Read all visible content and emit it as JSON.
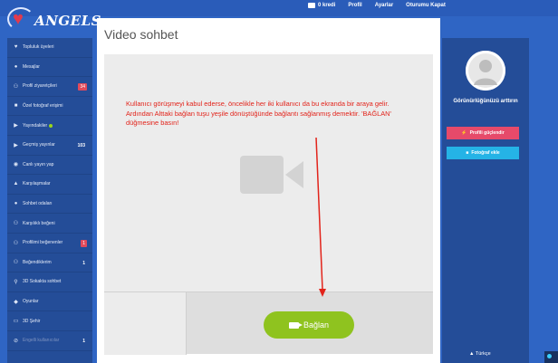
{
  "topnav": {
    "credits": "0 kredi",
    "profile": "Profil",
    "settings": "Ayarlar",
    "logout": "Oturumu Kapat"
  },
  "logo": {
    "text": "ANGELS"
  },
  "sidebar": {
    "items": [
      {
        "label": "Topluluk üyeleri",
        "icon": "heart-icon"
      },
      {
        "label": "Mesajlar",
        "icon": "chat-icon"
      },
      {
        "label": "Profil ziyaretçileri",
        "icon": "users-icon",
        "badge": "34"
      },
      {
        "label": "Özel fotoğraf erişimi",
        "icon": "camera-icon"
      },
      {
        "label": "Yayındakiler",
        "icon": "video-icon"
      },
      {
        "label": "Geçmiş yayınlar",
        "icon": "video-icon",
        "badge": "103"
      },
      {
        "label": "Canlı yayın yap",
        "icon": "eye-icon"
      },
      {
        "label": "Karşılaşmalar",
        "icon": "flame-icon"
      },
      {
        "label": "Sohbet odaları",
        "icon": "rooms-icon"
      },
      {
        "label": "Karşılıklı beğeni",
        "icon": "mutual-icon"
      },
      {
        "label": "Profilimi beğenenler",
        "icon": "likers-icon",
        "badge": "1"
      },
      {
        "label": "Beğendiklerim",
        "icon": "liked-icon",
        "badge": "1"
      },
      {
        "label": "3D Sokakta sohbet",
        "icon": "pin-icon"
      },
      {
        "label": "Oyunlar",
        "icon": "gamepad-icon"
      },
      {
        "label": "3D Şehir",
        "icon": "city-icon"
      },
      {
        "label": "Engelli kullanıcılar",
        "icon": "block-icon",
        "badge": "1"
      }
    ]
  },
  "main": {
    "title": "Video sohbet",
    "instruction": "Kullanıcı görüşmeyi kabul ederse, öncelikle her iki kullanıcı da bu ekranda bir araya gelir. Ardından Alttaki bağlan tuşu yeşile dönüştüğünde bağlantı sağlanmış demektir. 'BAĞLAN' düğmesine basın!",
    "connect_label": "Bağlan"
  },
  "right": {
    "visibility_text": "Görünürlüğünüzü arttırın",
    "boost_label": "Profili güçlendir",
    "photo_label": "Fotoğraf ekle",
    "language": "Türkçe"
  },
  "colors": {
    "accent": "#2f65c4",
    "sidebar": "#244d98",
    "connect": "#8fc31f",
    "boost": "#e64a6a",
    "photo": "#25b3e6",
    "annotation": "#e2231a"
  }
}
